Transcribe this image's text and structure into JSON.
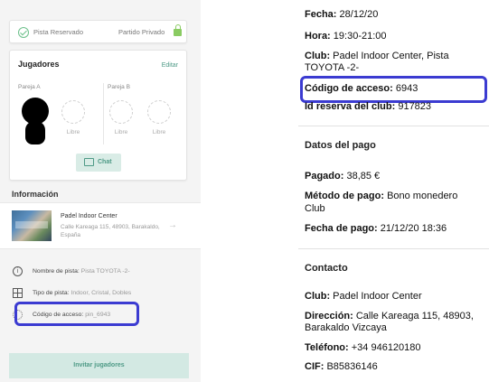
{
  "booking": {
    "status_reserved": "Pista Reservado",
    "status_private": "Partido Privado",
    "players": {
      "title": "Jugadores",
      "edit_label": "Editar",
      "team_a": "Pareja A",
      "team_b": "Pareja B",
      "free_label": "Libre",
      "chat_label": "Chat"
    },
    "info": {
      "title": "Información",
      "club_name": "Padel Indoor Center",
      "club_address": "Calle Kareaga 115, 48903, Barakaldo, España",
      "court_name_label": "Nombre de pista:",
      "court_name_value": "Pista TOYOTA -2-",
      "court_type_label": "Tipo de pista:",
      "court_type_value": "Indoor, Cristal, Dobles",
      "access_code_label": "Código de acceso:",
      "access_code_value": "pin_6943"
    },
    "invite_label": "Invitar jugadores"
  },
  "receipt": {
    "date_label": "Fecha:",
    "date_value": "28/12/20",
    "time_label": "Hora:",
    "time_value": "19:30-21:00",
    "club_label": "Club:",
    "club_value_line1": "Padel Indoor Center, Pista",
    "club_value_line2": "TOYOTA -2-",
    "access_code_label": "Código de acceso:",
    "access_code_value": "6943",
    "reservation_label": "Id reserva del club:",
    "reservation_value": "917823",
    "payment_header": "Datos del pago",
    "paid_label": "Pagado:",
    "paid_value": "38,85 €",
    "method_label": "Método de pago:",
    "method_value_line1": "Bono monedero",
    "method_value_line2": "Club",
    "pay_date_label": "Fecha de pago:",
    "pay_date_value": "21/12/20 18:36",
    "contact_header": "Contacto",
    "contact_club_label": "Club:",
    "contact_club_value": "Padel Indoor Center",
    "address_label": "Dirección:",
    "address_value_line1": "Calle Kareaga 115, 48903,",
    "address_value_line2": "Barakaldo Vizcaya",
    "phone_label": "Teléfono:",
    "phone_value": "+34 946120180",
    "cif_label": "CIF:",
    "cif_value": "B85836146"
  },
  "colors": {
    "accent": "#4e9a86",
    "highlight": "#3b3bd1",
    "lock": "#8acb62"
  }
}
